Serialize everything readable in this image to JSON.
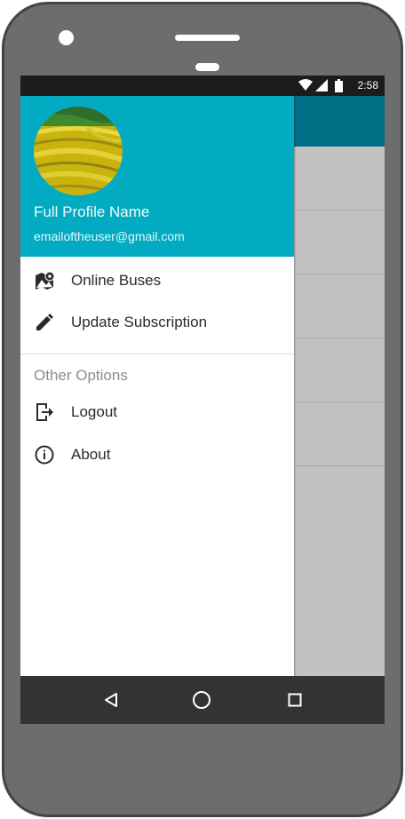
{
  "status_bar": {
    "time": "2:58",
    "wifi_icon": "wifi-icon",
    "signal_icon": "signal-icon",
    "battery_icon": "battery-icon"
  },
  "drawer": {
    "profile": {
      "name": "Full Profile Name",
      "email": "emailoftheuser@gmail.com",
      "avatar": "landscape-photo"
    },
    "items": [
      {
        "label": "Online Buses",
        "icon": "map-marker-icon"
      },
      {
        "label": "Update Subscription",
        "icon": "pencil-icon"
      }
    ],
    "section": {
      "title": "Other Options"
    },
    "other_items": [
      {
        "label": "Logout",
        "icon": "logout-icon"
      },
      {
        "label": "About",
        "icon": "info-icon"
      }
    ]
  },
  "colors": {
    "header": "#02abc2",
    "appbar": "#006f85",
    "statusbar": "#1c1c1c",
    "navbar": "#333333"
  },
  "nav_bar": {
    "back_icon": "back-icon",
    "home_icon": "home-icon",
    "recents_icon": "recents-icon"
  }
}
